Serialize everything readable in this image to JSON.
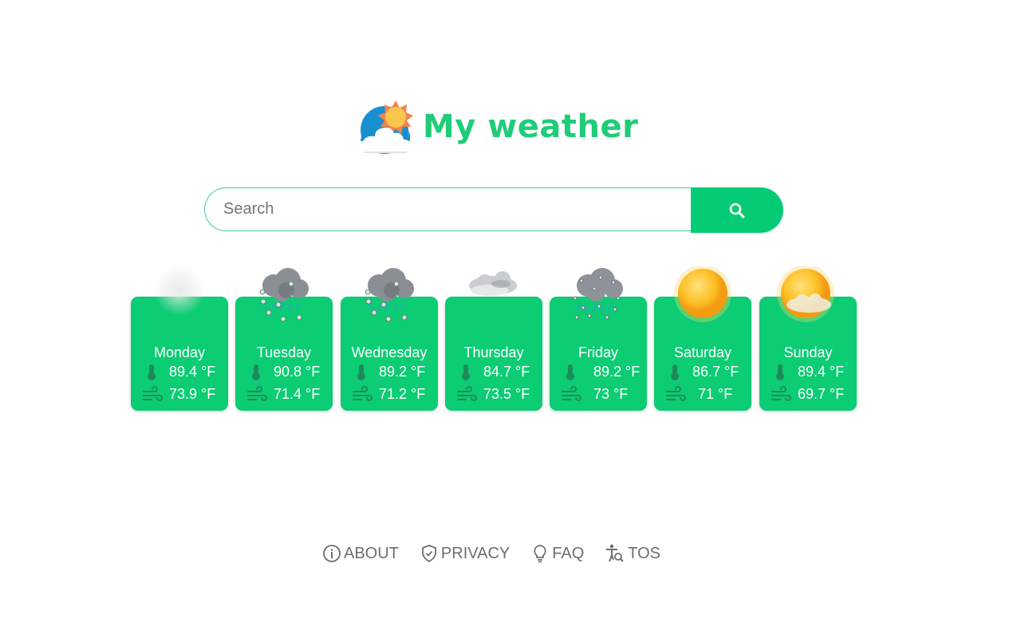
{
  "app": {
    "title": "My weather",
    "brand_color": "#1fcc78",
    "card_color": "#0ccc74",
    "logo_icon": "sun-cloud-logo-icon"
  },
  "search": {
    "placeholder": "Search",
    "value": "",
    "button_icon": "search-icon"
  },
  "forecast": [
    {
      "day": "Monday",
      "temp": "89.4 °F",
      "wind": "73.9 °F",
      "condition": "fog"
    },
    {
      "day": "Tuesday",
      "temp": "90.8 °F",
      "wind": "71.4 °F",
      "condition": "hail-rain"
    },
    {
      "day": "Wednesday",
      "temp": "89.2 °F",
      "wind": "71.2 °F",
      "condition": "hail-rain"
    },
    {
      "day": "Thursday",
      "temp": "84.7 °F",
      "wind": "73.5 °F",
      "condition": "cloudy"
    },
    {
      "day": "Friday",
      "temp": "89.2 °F",
      "wind": "73 °F",
      "condition": "sleet"
    },
    {
      "day": "Saturday",
      "temp": "86.7 °F",
      "wind": "71 °F",
      "condition": "sunny"
    },
    {
      "day": "Sunday",
      "temp": "89.4 °F",
      "wind": "69.7 °F",
      "condition": "partly-cloudy"
    }
  ],
  "footer": {
    "links": [
      {
        "label": "ABOUT",
        "icon": "info-icon"
      },
      {
        "label": "PRIVACY",
        "icon": "shield-check-icon"
      },
      {
        "label": "FAQ",
        "icon": "lightbulb-icon"
      },
      {
        "label": "TOS",
        "icon": "accessibility-search-icon"
      }
    ]
  }
}
